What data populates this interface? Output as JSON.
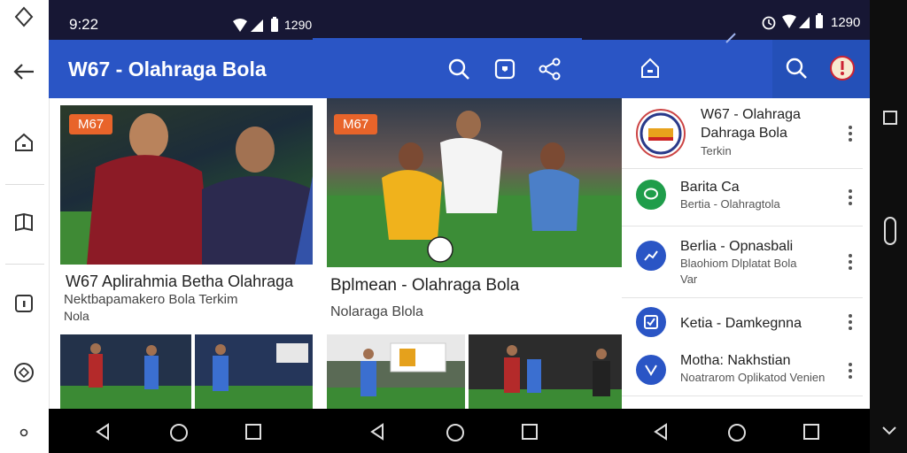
{
  "status": {
    "time": "9:22",
    "right_clock": "1290"
  },
  "panel1": {
    "title": "W67 - Olahraga Bola",
    "hero_badge": "M67",
    "heading": "W67 Aplirahmia Betha Olahraga",
    "subheading": "Nektbapamakero Bola Terkim",
    "caption": "Nola"
  },
  "panel2": {
    "hero_badge": "M67",
    "heading": "Bplmean - Olahraga Bola",
    "subheading": "Nolaraga Blola"
  },
  "panel3": {
    "list": [
      {
        "title": "W67 - Olahraga",
        "title2": "Dahraga Bola",
        "sub": "Terkin",
        "icon": "logo-badge"
      },
      {
        "title": "Barita Ca",
        "sub": "Bertia - Olahragtola",
        "icon": "chat-bubble-icon",
        "color": "#1f9d4a"
      },
      {
        "title": "Berlia - Opnasbali",
        "sub": "Blaohiom Dlplatat Bola",
        "sub2": "Var",
        "icon": "chart-line-icon",
        "color": "#2a55c5"
      },
      {
        "title": "Ketia - Damkegnna",
        "sub": "",
        "icon": "checkbox-icon",
        "color": "#2a55c5"
      },
      {
        "title": "Motha: Nakhstian",
        "sub": "Noatrarom Oplikatod Venien",
        "icon": "mail-icon",
        "color": "#2a55c5"
      }
    ]
  },
  "colors": {
    "appbar": "#2a55c5",
    "status": "#171734",
    "badge": "#e8642a"
  }
}
